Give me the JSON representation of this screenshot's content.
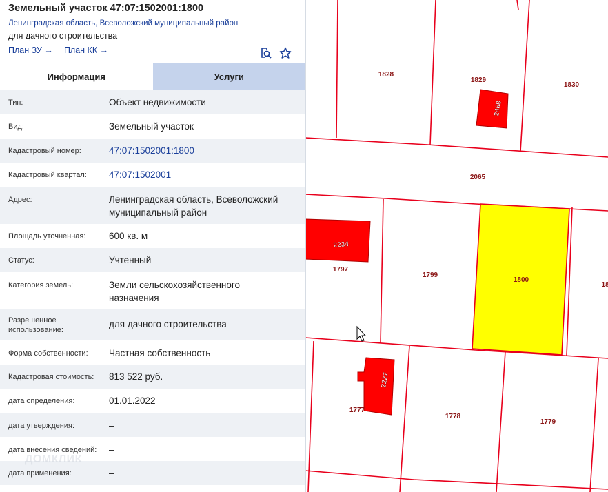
{
  "header": {
    "title": "Земельный участок 47:07:1502001:1800",
    "region": "Ленинградская область, Всеволожский муниципальный район",
    "usage": "для дачного строительства",
    "plan_zu": "План ЗУ →",
    "plan_kk": "План КК →"
  },
  "tabs": [
    "Информация",
    "Услуги"
  ],
  "rows": [
    {
      "label": "Тип:",
      "value": "Объект недвижимости"
    },
    {
      "label": "Вид:",
      "value": "Земельный участок"
    },
    {
      "label": "Кадастровый номер:",
      "value": "47:07:1502001:1800"
    },
    {
      "label": "Кадастровый квартал:",
      "value": "47:07:1502001"
    },
    {
      "label": "Адрес:",
      "value": "Ленинградская область, Всеволожский муниципальный район"
    },
    {
      "label": "Площадь уточненная:",
      "value": "600 кв. м"
    },
    {
      "label": "Статус:",
      "value": "Учтенный"
    },
    {
      "label": "Категория земель:",
      "value": "Земли сельскохозяйственного назначения"
    },
    {
      "label": "Разрешенное использование:",
      "value": "для дачного строительства"
    },
    {
      "label": "Форма собственности:",
      "value": "Частная собственность"
    },
    {
      "label": "Кадастровая стоимость:",
      "value": "813 522 руб."
    },
    {
      "label": "дата определения:",
      "value": "01.01.2022"
    },
    {
      "label": "дата утверждения:",
      "value": "–"
    },
    {
      "label": "дата внесения сведений:",
      "value": "–"
    },
    {
      "label": "дата применения:",
      "value": "–"
    }
  ],
  "watermark": "ДОМКЛИК",
  "map": {
    "parcels": [
      "1828",
      "1829",
      "1830",
      "2065",
      "1797",
      "1799",
      "1800",
      "18",
      "1777",
      "1778",
      "1779"
    ],
    "buildings": [
      "2468",
      "2234",
      "2227"
    ]
  },
  "colors": {
    "boundary": "#e8001c",
    "selected": "#ffff00",
    "building": "#ff0000",
    "tab_inactive": "#c5d3ec",
    "link": "#1a3f9a"
  }
}
